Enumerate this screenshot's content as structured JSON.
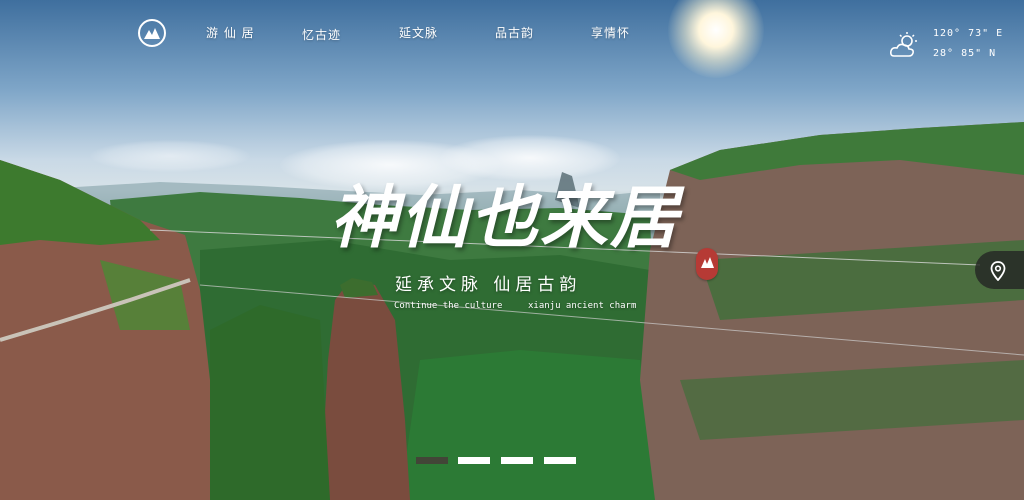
{
  "nav": {
    "logo_icon": "mountain-logo-icon",
    "items": [
      {
        "label": "游 仙 居"
      },
      {
        "label": "忆古迹"
      },
      {
        "label": "延文脉"
      },
      {
        "label": "品古韵"
      },
      {
        "label": "享情怀"
      }
    ]
  },
  "weather": {
    "icon": "partly-sunny-icon",
    "lon": "120° 73\" E",
    "lat": "28° 85\" N"
  },
  "hero": {
    "title": "神仙也来居",
    "subtitle": "延承文脉 仙居古韵",
    "sub_en_left": "Continue the culture",
    "sub_en_right": "xianju ancient charm",
    "seal_icon": "red-seal-icon",
    "accent_color": "#b63a35"
  },
  "side": {
    "location_icon": "location-pin-icon"
  },
  "carousel": {
    "count": 4,
    "active_index": 0
  }
}
